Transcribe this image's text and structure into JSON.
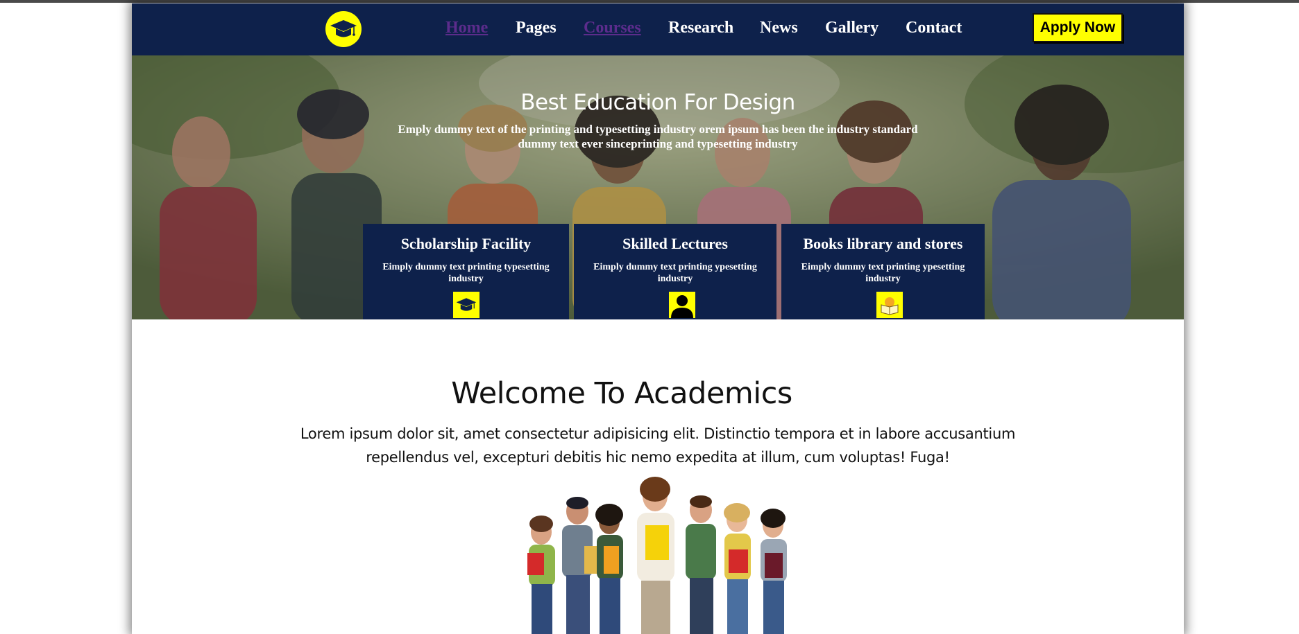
{
  "nav": {
    "logo_icon": "graduation-cap-icon",
    "links": [
      "Home",
      "Pages",
      "Courses",
      "Research",
      "News",
      "Gallery",
      "Contact"
    ],
    "apply_label": "Apply Now"
  },
  "hero": {
    "title": "Best Education For Design",
    "subtitle_line1": "Emply dummy text of the printing and typesetting industry orem ipsum has been the industry standard",
    "subtitle_line2": "dummy text ever sinceprinting and typesetting industry",
    "features": [
      {
        "title": "Scholarship Facility",
        "text": "Eimply dummy text printing typesetting industry",
        "icon": "graduation-cap-icon"
      },
      {
        "title": "Skilled Lectures",
        "text": "Eimply dummy text printing ypesetting industry",
        "icon": "person-icon"
      },
      {
        "title": "Books library and stores",
        "text": "Eimply dummy text printing ypesetting industry",
        "icon": "book-icon"
      }
    ]
  },
  "welcome": {
    "title": "Welcome To Academics",
    "text_line1": "Lorem ipsum dolor sit, amet consectetur adipisicing elit. Distinctio tempora et in labore accusantium",
    "text_line2": "repellendus vel, excepturi debitis hic nemo expedita at illum, cum voluptas! Fuga!"
  },
  "colors": {
    "navy": "#0e214b",
    "accent_yellow": "#ffff00",
    "visited_link": "#5c2c8c"
  }
}
